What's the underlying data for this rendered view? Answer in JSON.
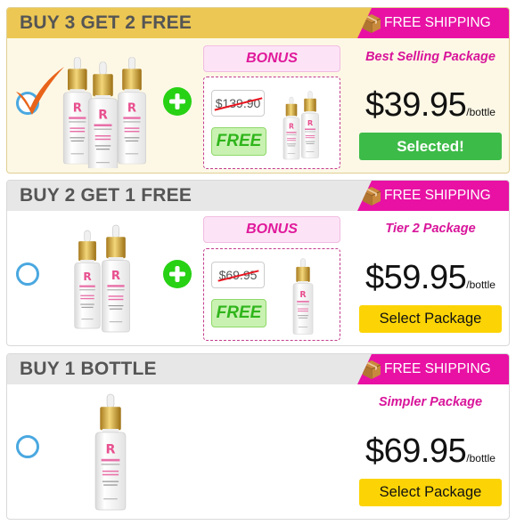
{
  "packages": [
    {
      "title": "BUY 3 GET 2 FREE",
      "shipping": "FREE SHIPPING",
      "bonus_label": "BONUS",
      "old_price": "$139.90",
      "free_label": "FREE",
      "package_name": "Best Selling Package",
      "price": "$39.95",
      "per": "/bottle",
      "button": "Selected!",
      "selected": true
    },
    {
      "title": "BUY 2 GET 1 FREE",
      "shipping": "FREE SHIPPING",
      "bonus_label": "BONUS",
      "old_price": "$69.95",
      "free_label": "FREE",
      "package_name": "Tier 2 Package",
      "price": "$59.95",
      "per": "/bottle",
      "button": "Select Package",
      "selected": false
    },
    {
      "title": "BUY 1 BOTTLE",
      "shipping": "FREE SHIPPING",
      "package_name": "Simpler Package",
      "price": "$69.95",
      "per": "/bottle",
      "button": "Select Package",
      "selected": false
    }
  ],
  "colors": {
    "accent_pink": "#e811a4",
    "selected_header": "#ecc754",
    "selected_button": "#3dbb48",
    "select_button": "#fcd406",
    "radio_blue": "#4aa8e0",
    "check_orange": "#e8641a"
  },
  "icons": {
    "shipping": "package-box-icon",
    "plus": "plus-icon",
    "check": "checkmark-icon"
  }
}
